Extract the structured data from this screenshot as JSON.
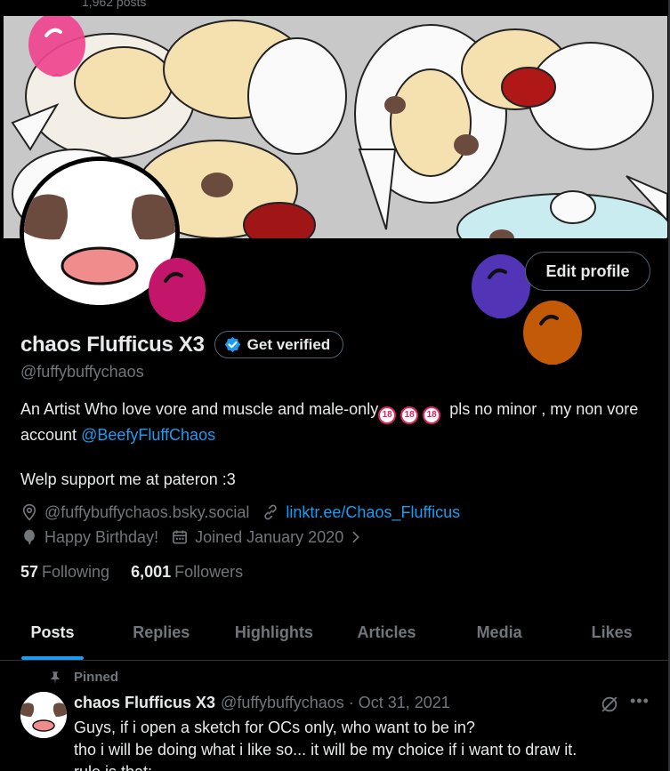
{
  "top": {
    "post_count": "1,962 posts"
  },
  "profile": {
    "display_name": "chaos Flufficus X3",
    "verify_label": "Get verified",
    "handle": "@fuffybuffychaos",
    "edit_label": "Edit profile",
    "bio_part1": "An Artist Who love vore and muscle and male-only",
    "bio_18": "18",
    "bio_part2": "pls no minor , my non vore account",
    "bio_mention": "@BeefyFluffChaos",
    "bio_line2": "Welp support me at pateron :3",
    "location": "@fuffybuffychaos.bsky.social",
    "website": "linktr.ee/Chaos_Flufficus",
    "birthday": "Happy Birthday!",
    "joined": "Joined January 2020",
    "following_count": "57",
    "following_label": "Following",
    "followers_count": "6,001",
    "followers_label": "Followers"
  },
  "tabs": [
    {
      "label": "Posts"
    },
    {
      "label": "Replies"
    },
    {
      "label": "Highlights"
    },
    {
      "label": "Articles"
    },
    {
      "label": "Media"
    },
    {
      "label": "Likes"
    }
  ],
  "tweet": {
    "pinned_label": "Pinned",
    "name": "chaos Flufficus X3",
    "meta": "@fuffybuffychaos · Oct 31, 2021",
    "line1": "Guys, if i open a sketch for OCs only, who want to be in?",
    "line2": "tho i will be doing what i like so... it will be my choice if i want to draw it.",
    "line3": "rule is that:"
  },
  "colors": {
    "accent": "#1d9bf0",
    "background": "#000000",
    "muted": "#71767b"
  }
}
